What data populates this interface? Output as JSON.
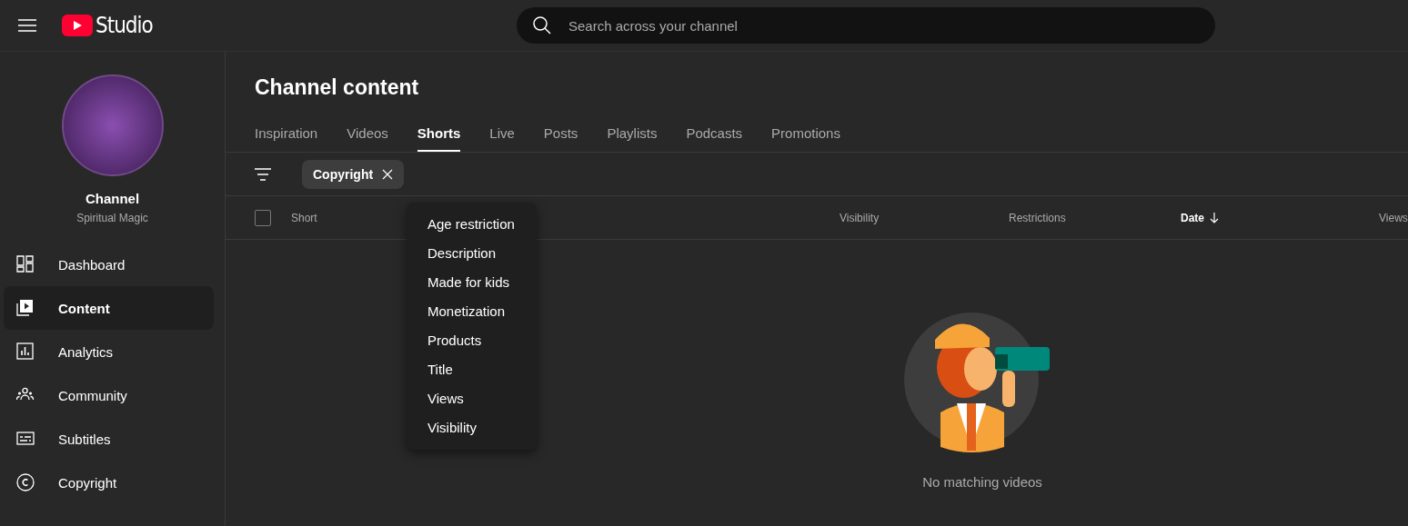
{
  "header": {
    "logo_text": "Studio",
    "search": {
      "placeholder": "Search across your channel"
    }
  },
  "sidebar": {
    "channel": {
      "title": "Channel",
      "name": "Spiritual Magic"
    },
    "items": [
      {
        "label": "Dashboard",
        "kind": "dashboard",
        "selected": false
      },
      {
        "label": "Content",
        "kind": "content",
        "selected": true
      },
      {
        "label": "Analytics",
        "kind": "analytics",
        "selected": false
      },
      {
        "label": "Community",
        "kind": "community",
        "selected": false
      },
      {
        "label": "Subtitles",
        "kind": "subtitles",
        "selected": false
      },
      {
        "label": "Copyright",
        "kind": "copyright",
        "selected": false
      }
    ]
  },
  "page_title": "Channel content",
  "tabs": [
    {
      "label": "Inspiration",
      "selected": false
    },
    {
      "label": "Videos",
      "selected": false
    },
    {
      "label": "Shorts",
      "selected": true
    },
    {
      "label": "Live",
      "selected": false
    },
    {
      "label": "Posts",
      "selected": false
    },
    {
      "label": "Playlists",
      "selected": false
    },
    {
      "label": "Podcasts",
      "selected": false
    },
    {
      "label": "Promotions",
      "selected": false
    }
  ],
  "filter_chips": [
    {
      "label": "Copyright"
    }
  ],
  "table": {
    "select_all_checked": false,
    "columns": [
      {
        "label": "Short",
        "sorted": false
      },
      {
        "label": "Visibility",
        "sorted": false
      },
      {
        "label": "Restrictions",
        "sorted": false
      },
      {
        "label": "Date",
        "sorted": true
      },
      {
        "label": "Views",
        "sorted": false
      }
    ],
    "empty_message": "No matching videos"
  },
  "filter_menu": {
    "items": [
      "Age restriction",
      "Description",
      "Made for kids",
      "Monetization",
      "Products",
      "Title",
      "Views",
      "Visibility"
    ]
  }
}
